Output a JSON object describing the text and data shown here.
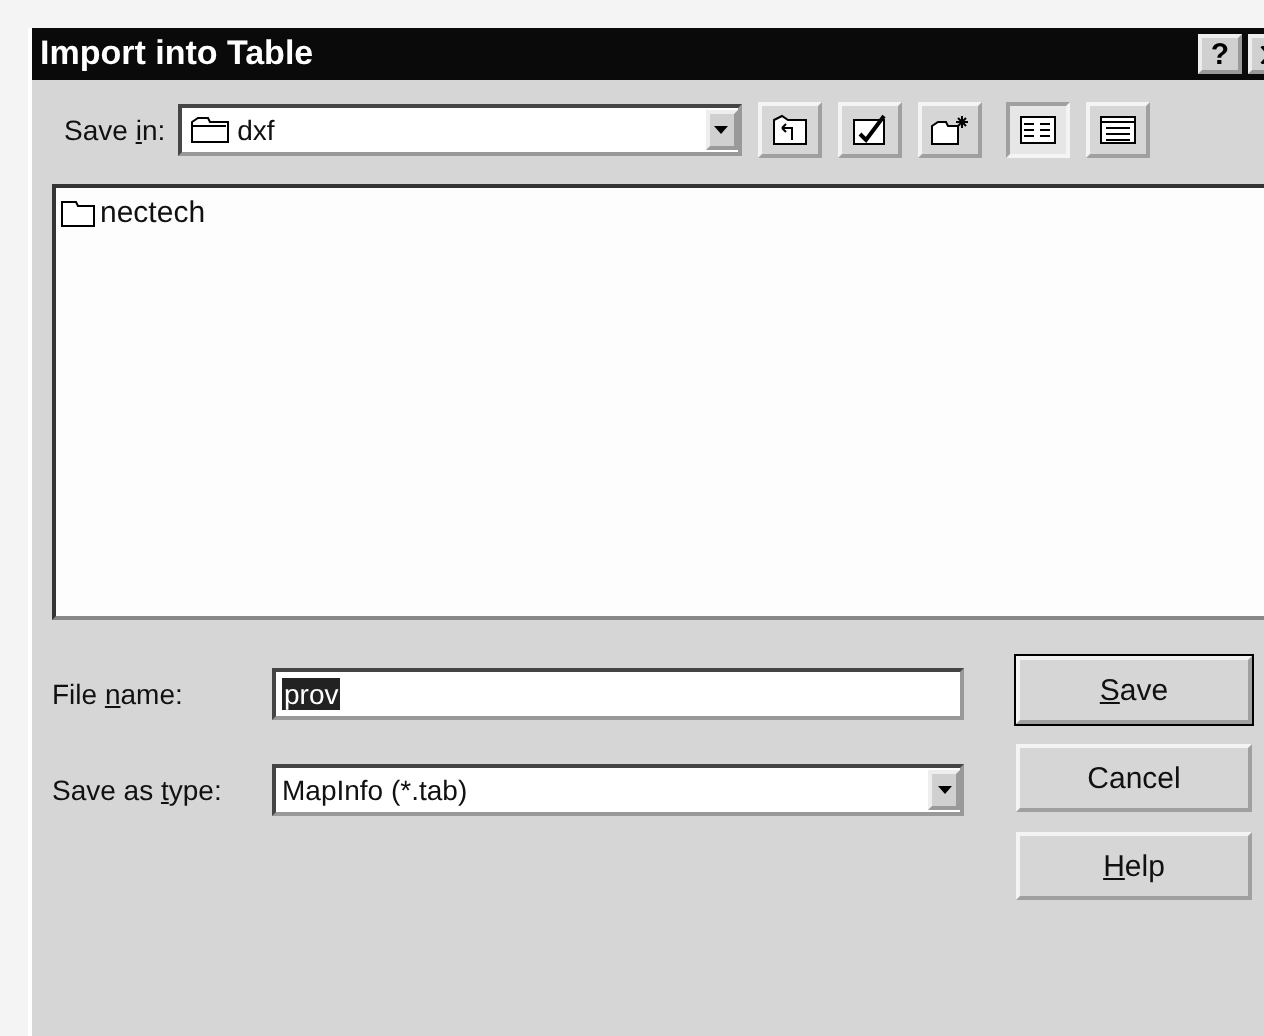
{
  "window": {
    "title": "Import into Table",
    "help_button": "?"
  },
  "save_in": {
    "label": {
      "pre": "Save ",
      "key": "i",
      "post": "n:"
    },
    "value": "dxf"
  },
  "toolbar": [
    {
      "kind": "up"
    },
    {
      "kind": "desktop"
    },
    {
      "kind": "new_folder"
    },
    {
      "kind": "list",
      "selected": true
    },
    {
      "kind": "details",
      "selected": false
    }
  ],
  "files": [
    {
      "name": "nectech",
      "kind": "folder"
    }
  ],
  "file_name": {
    "label": {
      "pre": "File ",
      "key": "n",
      "post": "ame:"
    },
    "value": "prov"
  },
  "save_as_type": {
    "label": {
      "pre": "Save as ",
      "key": "t",
      "post": "ype:"
    },
    "value": "MapInfo (*.tab)"
  },
  "buttons": [
    {
      "label": {
        "key": "S",
        "post": "ave"
      },
      "default": true
    },
    {
      "label": {
        "pre": "Cancel"
      },
      "default": false
    },
    {
      "label": {
        "key": "H",
        "post": "elp"
      },
      "default": false
    }
  ]
}
